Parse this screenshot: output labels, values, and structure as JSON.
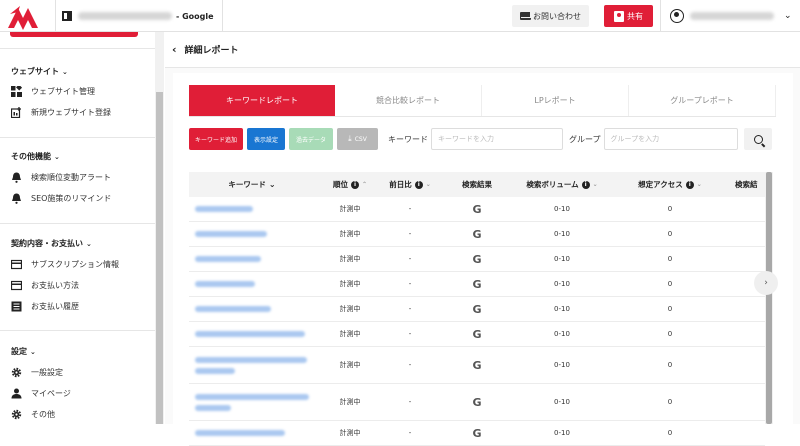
{
  "topbar": {
    "site_suffix": "- Google",
    "contact_label": "お問い合わせ",
    "share_label": "共有"
  },
  "sidebar": {
    "sections": [
      {
        "title": "ウェブサイト",
        "items": [
          "ウェブサイト管理",
          "新規ウェブサイト登録"
        ]
      },
      {
        "title": "その他機能",
        "items": [
          "検索順位変動アラート",
          "SEO施策のリマインド"
        ]
      },
      {
        "title": "契約内容・お支払い",
        "items": [
          "サブスクリプション情報",
          "お支払い方法",
          "お支払い履歴"
        ]
      },
      {
        "title": "設定",
        "items": [
          "一般設定",
          "マイページ",
          "その他"
        ]
      }
    ]
  },
  "header": {
    "title": "詳細レポート"
  },
  "tabs": [
    "キーワードレポート",
    "競合比較レポート",
    "LPレポート",
    "グループレポート"
  ],
  "toolbar": {
    "add_keyword": "キーワード追加",
    "display_settings": "表示設定",
    "past_data": "過去データ",
    "csv": "CSV",
    "keyword_label": "キーワード",
    "keyword_placeholder": "キーワードを入力",
    "group_label": "グループ",
    "group_placeholder": "グループを入力"
  },
  "table": {
    "headers": [
      "キーワード",
      "順位",
      "前日比",
      "検索結果",
      "検索ボリューム",
      "想定アクセス",
      "検索結"
    ],
    "rows": [
      {
        "rank": "計測中",
        "diff": "-",
        "engine": "G",
        "volume": "0-10",
        "access": "0"
      },
      {
        "rank": "計測中",
        "diff": "-",
        "engine": "G",
        "volume": "0-10",
        "access": "0"
      },
      {
        "rank": "計測中",
        "diff": "-",
        "engine": "G",
        "volume": "0-10",
        "access": "0"
      },
      {
        "rank": "計測中",
        "diff": "-",
        "engine": "G",
        "volume": "0-10",
        "access": "0"
      },
      {
        "rank": "計測中",
        "diff": "-",
        "engine": "G",
        "volume": "0-10",
        "access": "0"
      },
      {
        "rank": "計測中",
        "diff": "-",
        "engine": "G",
        "volume": "0-10",
        "access": "0"
      },
      {
        "rank": "計測中",
        "diff": "-",
        "engine": "G",
        "volume": "0-10",
        "access": "0"
      },
      {
        "rank": "計測中",
        "diff": "-",
        "engine": "G",
        "volume": "0-10",
        "access": "0"
      },
      {
        "rank": "計測中",
        "diff": "-",
        "engine": "G",
        "volume": "0-10",
        "access": "0"
      }
    ]
  },
  "colors": {
    "accent": "#e01e37",
    "blue": "#1976d2",
    "green": "#a8dbb7"
  }
}
